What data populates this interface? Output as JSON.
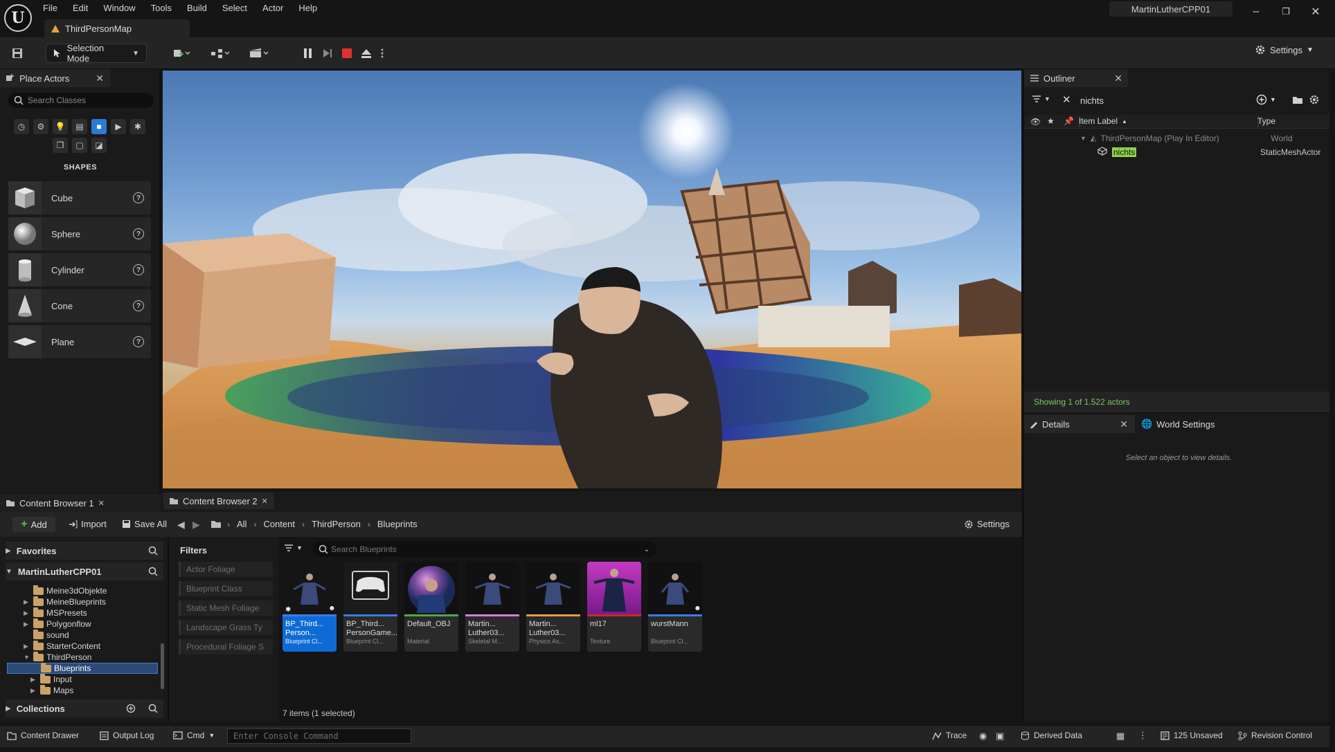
{
  "app": {
    "logo_glyph": "U",
    "menu": [
      "File",
      "Edit",
      "Window",
      "Tools",
      "Build",
      "Select",
      "Actor",
      "Help"
    ],
    "project_name": "MartinLutherCPP01",
    "map_tab": "ThirdPersonMap",
    "window_controls": [
      "–",
      "❐",
      "✕"
    ]
  },
  "toolbar": {
    "selection_mode": "Selection Mode",
    "settings_label": "Settings"
  },
  "place_actors": {
    "title": "Place Actors",
    "search_placeholder": "Search Classes",
    "section_title": "SHAPES",
    "shapes": [
      {
        "label": "Cube",
        "icon": "cube-icon"
      },
      {
        "label": "Sphere",
        "icon": "sphere-icon"
      },
      {
        "label": "Cylinder",
        "icon": "cylinder-icon"
      },
      {
        "label": "Cone",
        "icon": "cone-icon"
      },
      {
        "label": "Plane",
        "icon": "plane-icon"
      }
    ],
    "help_glyph": "?"
  },
  "outliner": {
    "title": "Outliner",
    "search_value": "nichts",
    "col_label": "Item Label",
    "col_type": "Type",
    "rows": [
      {
        "label": "ThirdPersonMap (Play In Editor)",
        "type": "World"
      },
      {
        "label": "nichts",
        "type": "StaticMeshActor"
      }
    ],
    "status": "Showing 1 of 1.522 actors"
  },
  "details": {
    "tab": "Details",
    "world_settings_tab": "World Settings",
    "empty_message": "Select an object to view details."
  },
  "content_browser": {
    "tab1": "Content Browser 1",
    "tab2": "Content Browser 2",
    "add": "Add",
    "import": "Import",
    "save_all": "Save All",
    "settings": "Settings",
    "breadcrumbs": [
      "All",
      "Content",
      "ThirdPerson",
      "Blueprints"
    ],
    "favorites": "Favorites",
    "project_root": "MartinLutherCPP01",
    "collections": "Collections",
    "filters_title": "Filters",
    "filters": [
      "Actor Foliage",
      "Blueprint Class",
      "Static Mesh Foliage",
      "Landscape Grass Ty",
      "Procedural Foliage S"
    ],
    "search_placeholder": "Search Blueprints",
    "item_count": "7 items (1 selected)",
    "tree": [
      {
        "label": "Meine3dObjekte",
        "expandable": false
      },
      {
        "label": "MeineBlueprints",
        "expandable": true
      },
      {
        "label": "MSPresets",
        "expandable": true
      },
      {
        "label": "Polygonflow",
        "expandable": true
      },
      {
        "label": "sound",
        "expandable": false
      },
      {
        "label": "StarterContent",
        "expandable": true
      },
      {
        "label": "ThirdPerson",
        "expandable": true
      },
      {
        "label": "Blueprints",
        "expandable": false
      },
      {
        "label": "Input",
        "expandable": true
      },
      {
        "label": "Maps",
        "expandable": true
      }
    ],
    "assets": [
      {
        "name": "BP_Third... Person...",
        "type": "Blueprint Cl...",
        "bar": "#3d7be6"
      },
      {
        "name": "BP_Third... PersonGame...",
        "type": "Blueprint Cl...",
        "bar": "#3d7be6"
      },
      {
        "name": "Default_OBJ",
        "type": "Material",
        "bar": "#4caa4c"
      },
      {
        "name": "Martin... Luther03...",
        "type": "Skeletal M...",
        "bar": "#d67ed6"
      },
      {
        "name": "Martin... Luther03...",
        "type": "Physics As...",
        "bar": "#e0a040"
      },
      {
        "name": "ml17",
        "type": "Texture",
        "bar": "#c22c2c"
      },
      {
        "name": "wurstMann",
        "type": "Blueprint Cl...",
        "bar": "#3d7be6"
      }
    ]
  },
  "statusbar": {
    "content_drawer": "Content Drawer",
    "output_log": "Output Log",
    "cmd": "Cmd",
    "console_placeholder": "Enter Console Command",
    "trace": "Trace",
    "derived_data": "Derived Data",
    "unsaved": "125 Unsaved",
    "revision_control": "Revision Control"
  }
}
